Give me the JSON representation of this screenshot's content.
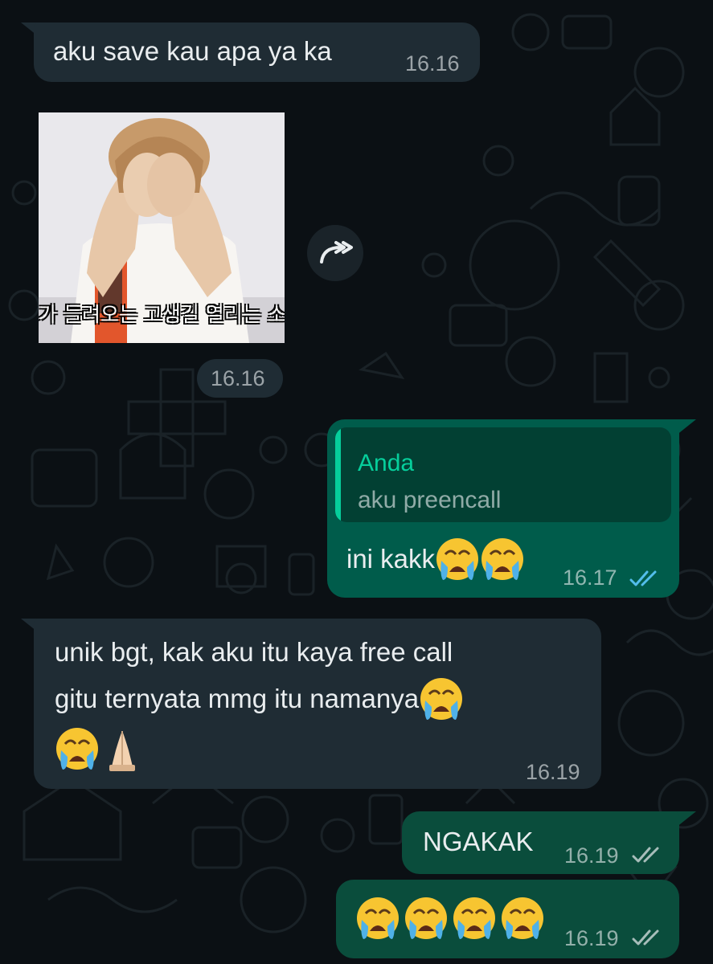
{
  "messages": {
    "m1": {
      "text": "aku save kau apa ya ka",
      "time": "16.16"
    },
    "sticker": {
      "subtitle": "가 들려오는 고생길 열리는 소",
      "time": "16.16"
    },
    "m2": {
      "reply_author": "Anda",
      "reply_text": "aku preencall",
      "text": "ini kakk",
      "time": "16.17",
      "status": "read"
    },
    "m3": {
      "line1": "unik bgt, kak aku itu kaya free call",
      "line2": "gitu ternyata mmg itu namanya",
      "time": "16.19"
    },
    "m4": {
      "text": "NGAKAK",
      "time": "16.19",
      "status": "delivered"
    },
    "m5": {
      "time": "16.19",
      "status": "delivered"
    }
  },
  "colors": {
    "background": "#0b1014",
    "incoming_bubble": "#1f2c34",
    "outgoing_bubble": "#005c4b",
    "quote_accent": "#06cf9c",
    "read_ticks": "#53bdeb"
  },
  "icons": [
    "forward-icon",
    "double-check-icon",
    "crying-face-emoji",
    "folded-hands-emoji"
  ]
}
